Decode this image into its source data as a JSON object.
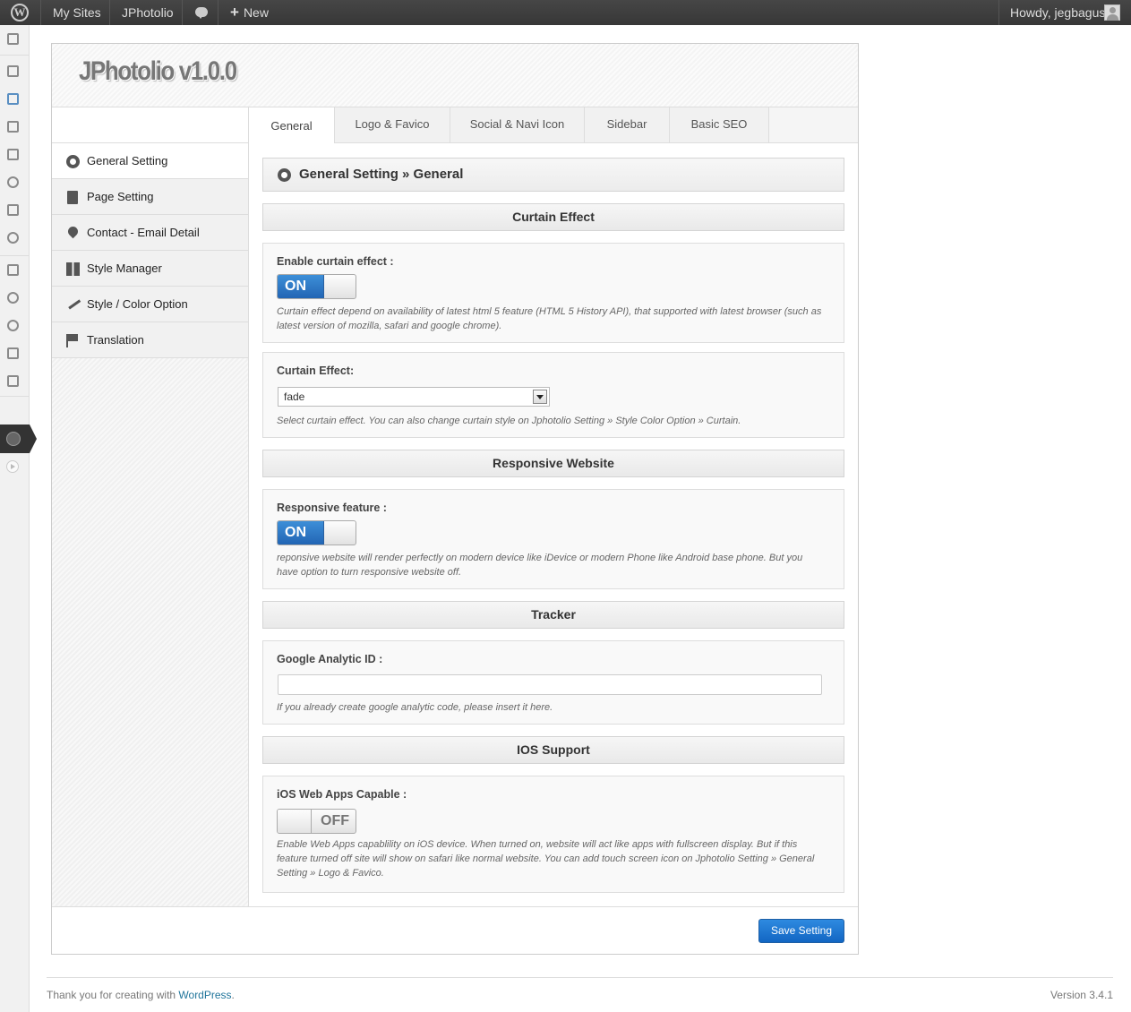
{
  "adminbar": {
    "my_sites": "My Sites",
    "site_name": "JPhotolio",
    "new_label": "New",
    "new_icon": "+",
    "howdy": "Howdy, jegbagus"
  },
  "admin_menu": {
    "icons": [
      "dashboard-icon",
      "posts-icon",
      "home-icon",
      "media-icon",
      "gallery-icon",
      "links-icon",
      "pages-icon",
      "comments-icon",
      "appearance-icon",
      "plugins-icon",
      "users-icon",
      "tools-icon",
      "settings-icon",
      "jphotolio-icon",
      "collapse-icon"
    ]
  },
  "panel": {
    "logo": "JPhotolio v1.0.0",
    "sidebar": [
      {
        "label": "General Setting",
        "icon": "gear-icon",
        "active": true
      },
      {
        "label": "Page Setting",
        "icon": "book-icon"
      },
      {
        "label": "Contact - Email Detail",
        "icon": "map-pin-icon"
      },
      {
        "label": "Style Manager",
        "icon": "layout-icon"
      },
      {
        "label": "Style / Color Option",
        "icon": "brush-icon"
      },
      {
        "label": "Translation",
        "icon": "flag-icon"
      }
    ],
    "tabs": [
      {
        "label": "General",
        "active": true
      },
      {
        "label": "Logo & Favico"
      },
      {
        "label": "Social & Navi Icon"
      },
      {
        "label": "Sidebar"
      },
      {
        "label": "Basic SEO"
      }
    ],
    "breadcrumb": "General Setting » General",
    "sections": {
      "curtain": "Curtain Effect",
      "responsive": "Responsive Website",
      "tracker": "Tracker",
      "ios": "IOS Support"
    },
    "fields": {
      "enable_curtain": {
        "label": "Enable curtain effect :",
        "state": "ON",
        "desc": "Curtain effect depend on availability of latest html 5 feature (HTML 5 History API), that supported with latest browser (such as latest version of mozilla, safari and google chrome)."
      },
      "curtain_effect": {
        "label": "Curtain Effect:",
        "value": "fade",
        "desc": "Select curtain effect. You can also change curtain style on Jphotolio Setting » Style Color Option » Curtain."
      },
      "responsive_feature": {
        "label": "Responsive feature :",
        "state": "ON",
        "desc": "reponsive website will render perfectly on modern device like iDevice or modern Phone like Android base phone. But you have option to turn responsive website off."
      },
      "google_analytic": {
        "label": "Google Analytic ID :",
        "value": "",
        "desc": "If you already create google analytic code, please insert it here."
      },
      "ios_webapps": {
        "label": "iOS Web Apps Capable :",
        "state": "OFF",
        "desc": "Enable Web Apps capablility on iOS device. When turned on, website will act like apps with fullscreen display. But if this feature turned off site will show on safari like normal website. You can add touch screen icon on Jphotolio Setting » General Setting » Logo & Favico."
      }
    },
    "save_label": "Save Setting"
  },
  "footer": {
    "thanks": "Thank you for creating with ",
    "link": "WordPress",
    "after": ".",
    "version": "Version 3.4.1"
  },
  "colors": {
    "accent": "#2265b4",
    "link": "#21759b"
  }
}
